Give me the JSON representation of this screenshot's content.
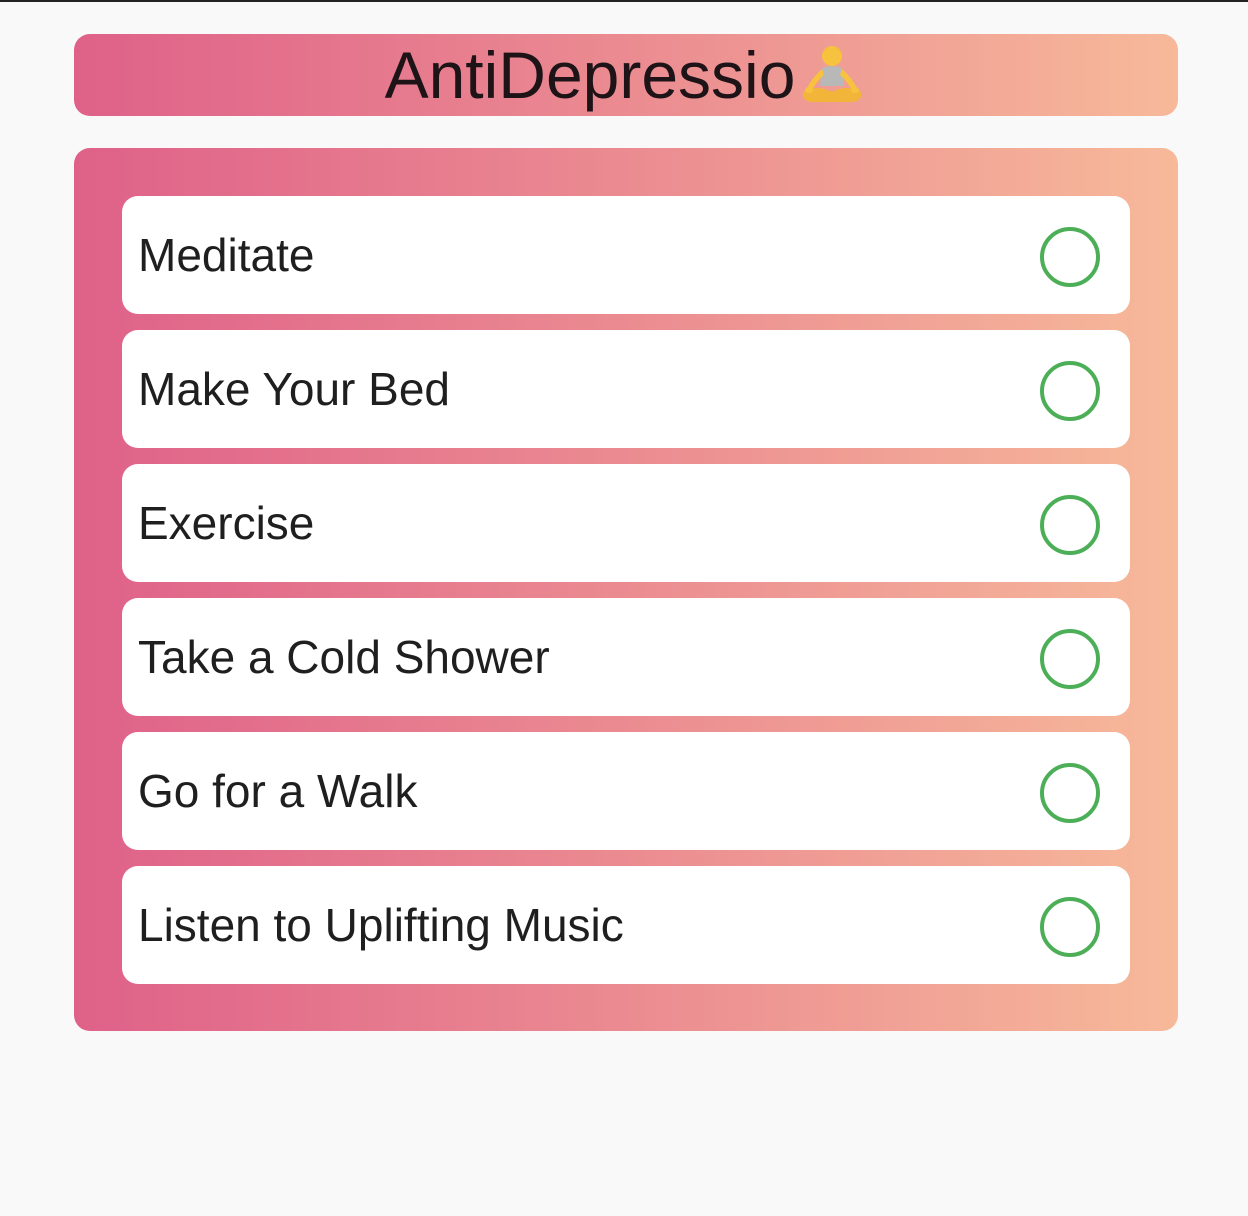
{
  "header": {
    "title": "AntiDepressio",
    "emoji_icon": "person-in-lotus-position-icon"
  },
  "tasks": [
    {
      "label": "Meditate",
      "checked": false
    },
    {
      "label": "Make Your Bed",
      "checked": false
    },
    {
      "label": "Exercise",
      "checked": false
    },
    {
      "label": "Take a Cold Shower",
      "checked": false
    },
    {
      "label": "Go for a Walk",
      "checked": false
    },
    {
      "label": "Listen to Uplifting Music",
      "checked": false
    }
  ],
  "colors": {
    "gradient_start": "#df6189",
    "gradient_mid": "#eb8b91",
    "gradient_end": "#f7b99a",
    "check_ring": "#4caf58",
    "page_background": "#f9f9f9",
    "card_background": "#ffffff"
  }
}
